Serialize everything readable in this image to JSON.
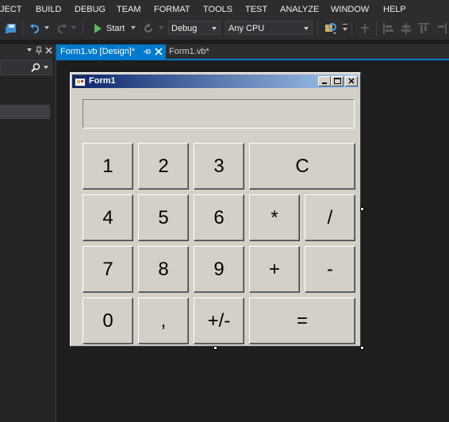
{
  "menu": [
    "JECT",
    "BUILD",
    "DEBUG",
    "TEAM",
    "FORMAT",
    "TOOLS",
    "TEST",
    "ANALYZE",
    "WINDOW",
    "HELP"
  ],
  "toolbar": {
    "start_label": "Start",
    "config_value": "Debug",
    "platform_value": "Any CPU"
  },
  "tabs": {
    "active": "Form1.vb [Design]*",
    "inactive": "Form1.vb*"
  },
  "form": {
    "title": "Form1",
    "display_value": ""
  },
  "keypad": {
    "k1": "1",
    "k2": "2",
    "k3": "3",
    "clear": "C",
    "k4": "4",
    "k5": "5",
    "k6": "6",
    "multiply": "*",
    "divide": "/",
    "k7": "7",
    "k8": "8",
    "k9": "9",
    "add": "+",
    "subtract": "-",
    "k0": "0",
    "decimal": ",",
    "negate": "+/-",
    "equals": "="
  },
  "colors": {
    "ide_background": "#1e1e1e",
    "accent": "#007acc",
    "form_face": "#d4d0c8",
    "start_green": "#5bb75b"
  }
}
